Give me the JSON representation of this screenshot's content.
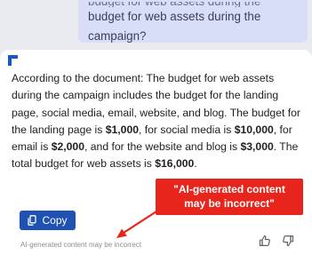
{
  "user_message": {
    "partial_line": "budget for web assets during the",
    "line_1": "budget for web assets during the",
    "line_2": "campaign?"
  },
  "response": {
    "s1": "According to the document: The budget for web assets during the campaign includes the budget for the landing page, social media, email, website, and blog. The budget for the landing page is ",
    "v1": "$1,000",
    "s2": ", for social media is ",
    "v2": "$10,000",
    "s3": ", for email is ",
    "v3": "$2,000",
    "s4": ", and for the website and blog is ",
    "v4": "$3,000",
    "s5": ". The total budget for web assets is ",
    "v5": "$16,000",
    "s6": "."
  },
  "actions": {
    "copy_label": "Copy",
    "disclaimer": "AI-generated content may be incorrect",
    "feedback_icons": [
      "thumbs-up-icon",
      "thumbs-down-icon"
    ]
  },
  "callout": {
    "line_1": "\"AI-generated content",
    "line_2": "may be incorrect\"",
    "color": "#e8251c"
  },
  "colors": {
    "accent": "#1f51b3",
    "user_bubble": "#d9def8"
  }
}
